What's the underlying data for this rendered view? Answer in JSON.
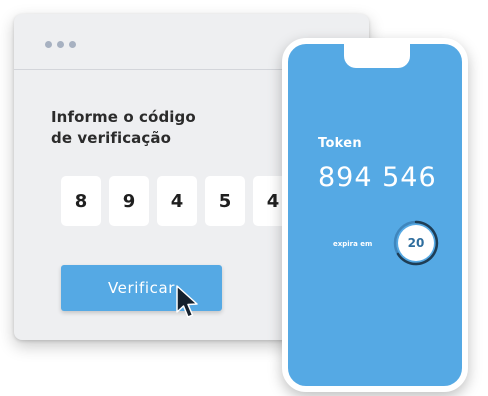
{
  "verification_window": {
    "prompt_line1": "Informe o código",
    "prompt_line2": "de verificação",
    "code_digits": [
      "8",
      "9",
      "4",
      "5",
      "4"
    ],
    "verify_button_label": "Verificar"
  },
  "phone": {
    "token_label": "Token",
    "token_value": "894 546",
    "expires_label": "expira em",
    "countdown_seconds": "20"
  },
  "colors": {
    "accent": "#55a9e4",
    "window_bg": "#eeeff1",
    "text_dark": "#2b2b2b"
  }
}
